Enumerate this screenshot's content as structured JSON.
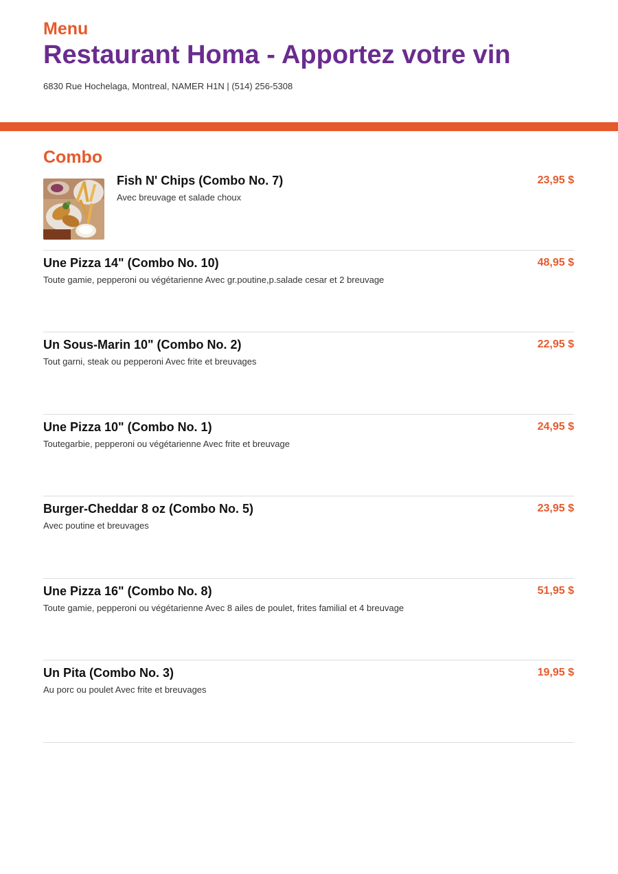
{
  "header": {
    "menu_label": "Menu",
    "restaurant_name": "Restaurant Homa - Apportez votre vin",
    "address": "6830 Rue Hochelaga, Montreal, NAMER H1N | (514) 256-5308"
  },
  "colors": {
    "accent": "#e55a2b",
    "brand": "#6a2c8f",
    "divider": "#dddddd"
  },
  "section": {
    "title": "Combo",
    "items": [
      {
        "name": "Fish N' Chips (Combo No. 7)",
        "description": "Avec breuvage et salade choux",
        "price": "23,95 $",
        "photo_icon": "fish-and-chips-photo"
      },
      {
        "name": "Une Pizza 14\" (Combo No. 10)",
        "description": "Toute gamie, pepperoni ou végétarienne Avec gr.poutine,p.salade cesar et 2 breuvage",
        "price": "48,95 $"
      },
      {
        "name": "Un Sous-Marin 10\" (Combo No. 2)",
        "description": "Tout garni, steak ou pepperoni Avec frite et breuvages",
        "price": "22,95 $"
      },
      {
        "name": "Une Pizza 10\" (Combo No. 1)",
        "description": "Toutegarbie, pepperoni ou végétarienne Avec frite et breuvage",
        "price": "24,95 $"
      },
      {
        "name": "Burger-Cheddar 8 oz  (Combo No. 5)",
        "description": "Avec poutine et breuvages",
        "price": "23,95 $"
      },
      {
        "name": "Une Pizza 16\" (Combo No. 8)",
        "description": "Toute gamie, pepperoni ou végétarienne Avec 8 ailes de poulet, frites familial et 4 breuvage",
        "price": "51,95 $"
      },
      {
        "name": "Un Pita (Combo No. 3)",
        "description": "Au porc ou poulet Avec frite et breuvages",
        "price": "19,95 $"
      }
    ]
  }
}
